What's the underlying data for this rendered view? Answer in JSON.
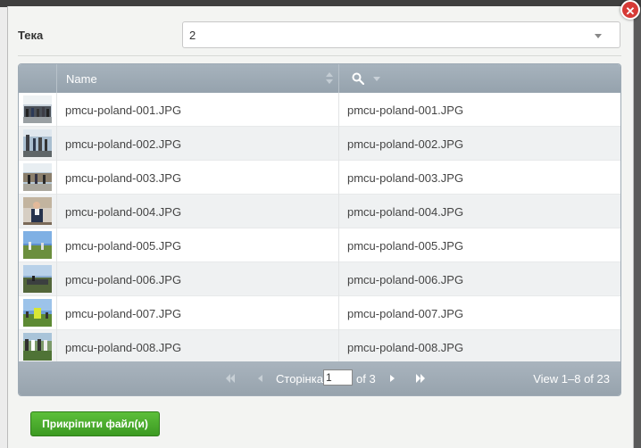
{
  "folder": {
    "label": "Тека",
    "selected": "2"
  },
  "grid": {
    "columns": {
      "name": "Name"
    },
    "rows": [
      {
        "name": "pmcu-poland-001.JPG",
        "title": "pmcu-poland-001.JPG"
      },
      {
        "name": "pmcu-poland-002.JPG",
        "title": "pmcu-poland-002.JPG"
      },
      {
        "name": "pmcu-poland-003.JPG",
        "title": "pmcu-poland-003.JPG"
      },
      {
        "name": "pmcu-poland-004.JPG",
        "title": "pmcu-poland-004.JPG"
      },
      {
        "name": "pmcu-poland-005.JPG",
        "title": "pmcu-poland-005.JPG"
      },
      {
        "name": "pmcu-poland-006.JPG",
        "title": "pmcu-poland-006.JPG"
      },
      {
        "name": "pmcu-poland-007.JPG",
        "title": "pmcu-poland-007.JPG"
      },
      {
        "name": "pmcu-poland-008.JPG",
        "title": "pmcu-poland-008.JPG"
      }
    ]
  },
  "pager": {
    "page_label": "Сторінка",
    "page_value": "1",
    "of_label": "of 3",
    "view_text": "View 1–8 of 23"
  },
  "attach_button": "Прикріпити файл(и)",
  "colors": {
    "header": "#9aa7b1",
    "accent_green": "#4aab2c",
    "close_red": "#d63a36"
  },
  "icons": [
    "close-icon",
    "chevron-down-icon",
    "sort-icon",
    "search-icon",
    "first-page-icon",
    "prev-page-icon",
    "next-page-icon",
    "last-page-icon"
  ]
}
